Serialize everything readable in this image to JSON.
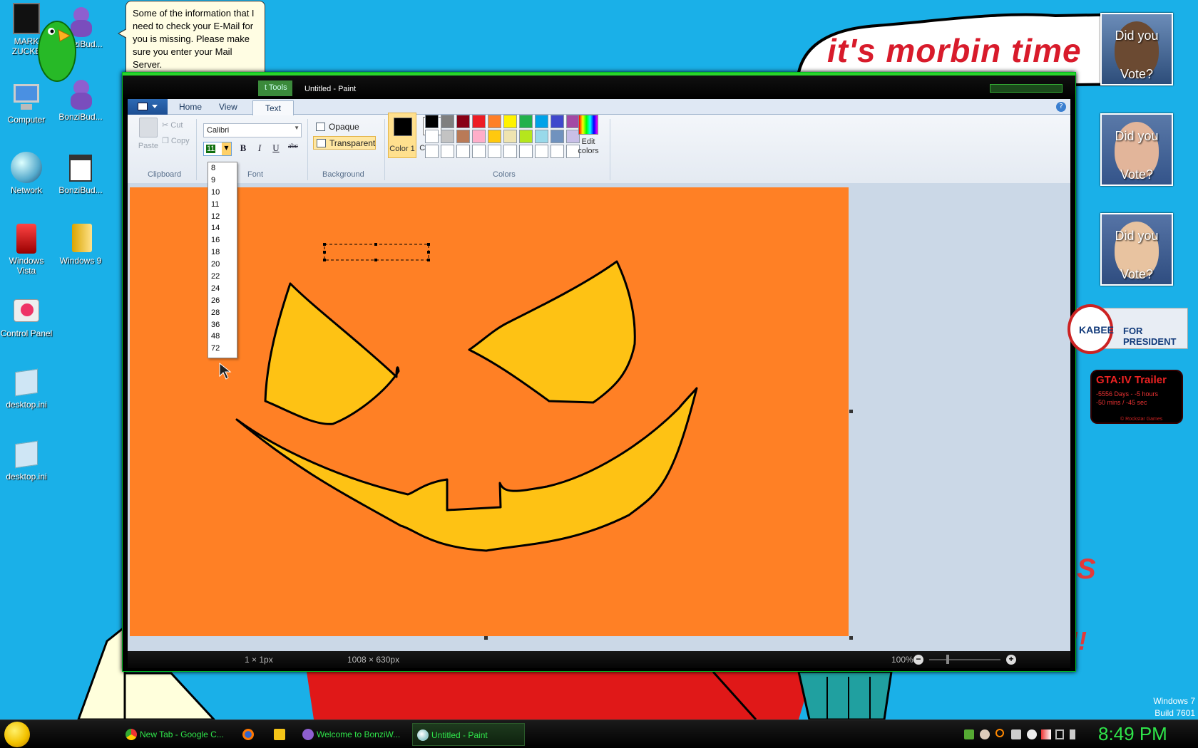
{
  "desktop": {
    "icons": [
      {
        "label": "MARK ZUCKE"
      },
      {
        "label": "BonziBud..."
      },
      {
        "label": "Computer"
      },
      {
        "label": "BonziBud..."
      },
      {
        "label": "Network"
      },
      {
        "label": "BonziBud..."
      },
      {
        "label": "Windows Vista"
      },
      {
        "label": "Windows 9"
      },
      {
        "label": "Control Panel"
      },
      {
        "label": "desktop.ini"
      },
      {
        "label": "desktop.ini"
      }
    ],
    "balloon_text": "Some of the information that I need to check your E-Mail for you is missing. Please make sure you enter your Mail Server.",
    "banner_text": "it's morbin time",
    "vote_boxes": [
      {
        "line1": "Did you",
        "line2": "Vote?"
      },
      {
        "line1": "Did you",
        "line2": "Vote?"
      },
      {
        "line1": "Did you",
        "line2": "Vote?"
      }
    ],
    "huckabee": {
      "left": "KABEE",
      "right": "FOR PRESIDENT"
    },
    "gta": {
      "title": "GTA:IV Trailer",
      "line1": "-5556 Days - -5 hours",
      "line2": "-50 mins / -45 sec",
      "footer": "© Rockstar Games"
    },
    "windows_version": {
      "line1": "Windows 7",
      "line2": "Build 7601"
    },
    "wallpaper_letters": {
      "s": "S",
      "marks": "!!"
    }
  },
  "paint": {
    "contextual_tab": "t Tools",
    "title": "Untitled - Paint",
    "tabs": [
      "Home",
      "View",
      "Text"
    ],
    "active_tab": "Text",
    "clipboard": {
      "paste": "Paste",
      "cut": "Cut",
      "copy": "Copy",
      "group": "Clipboard"
    },
    "font": {
      "family": "Calibri",
      "size": "11",
      "bold": "B",
      "italic": "I",
      "underline": "U",
      "strike": "abc",
      "group": "Font"
    },
    "background": {
      "opaque": "Opaque",
      "transparent": "Transparent",
      "group": "Background"
    },
    "colors": {
      "color1_label": "Color 1",
      "color2_label": "Color 2",
      "color1": "#000000",
      "color2": "#ffffff",
      "edit_label": "Edit colors",
      "group": "Colors",
      "palette": [
        "#000000",
        "#7f7f7f",
        "#880015",
        "#ed1c24",
        "#ff7f27",
        "#fff200",
        "#22b14c",
        "#00a2e8",
        "#3f48cc",
        "#a349a4",
        "#ffffff",
        "#c3c3c3",
        "#b97a57",
        "#ffaec9",
        "#ffc90e",
        "#efe4b0",
        "#b5e61d",
        "#99d9ea",
        "#7092be",
        "#c8bfe7",
        "#ffffff",
        "#ffffff",
        "#ffffff",
        "#ffffff",
        "#ffffff",
        "#ffffff",
        "#ffffff",
        "#ffffff",
        "#ffffff",
        "#ffffff"
      ]
    },
    "canvas_color": "#ff8025",
    "face_fill": "#fec214",
    "font_sizes": [
      "8",
      "9",
      "10",
      "11",
      "12",
      "14",
      "16",
      "18",
      "20",
      "22",
      "24",
      "26",
      "28",
      "36",
      "48",
      "72"
    ],
    "status": {
      "selection": "1 × 1px",
      "size": "1008 × 630px",
      "zoom": "100%"
    }
  },
  "taskbar": {
    "items": [
      {
        "label": "New Tab - Google C..."
      },
      {
        "label": ""
      },
      {
        "label": ""
      },
      {
        "label": "Welcome to BonziW..."
      },
      {
        "label": "Untitled - Paint"
      }
    ],
    "clock": "8:49 PM"
  }
}
